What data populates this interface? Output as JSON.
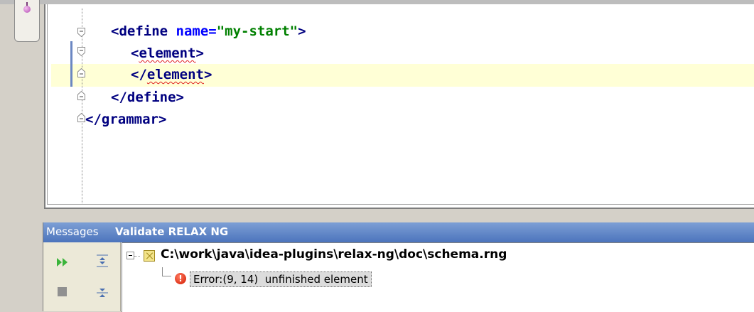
{
  "editor": {
    "lines": [
      {
        "parts": [
          [
            "tag",
            "<define "
          ],
          [
            "attr",
            "name="
          ],
          [
            "str",
            "\"my-start\""
          ],
          [
            "tag",
            ">"
          ]
        ]
      },
      {
        "parts": [
          [
            "tag",
            "<"
          ],
          [
            "tagerr",
            "element"
          ],
          [
            "tag",
            ">"
          ]
        ]
      },
      {
        "parts": [
          [
            "tag",
            "</"
          ],
          [
            "tagerr",
            "element"
          ],
          [
            "tag",
            ">"
          ]
        ]
      },
      {
        "parts": [
          [
            "tag",
            "</define>"
          ]
        ]
      },
      {
        "parts": [
          [
            "tag",
            "</grammar>"
          ]
        ]
      }
    ]
  },
  "messages": {
    "title": "Messages",
    "tab": "Validate RELAX NG",
    "file_path": "C:\\work\\java\\idea-plugins\\relax-ng\\doc\\schema.rng",
    "error_text": "Error:(9, 14)  unfinished element"
  },
  "icons": {
    "rerun": "rerun-icon",
    "stop": "stop-icon",
    "expand_all": "expand-all-icon",
    "collapse_all": "collapse-all-icon",
    "error": "error-icon",
    "file": "rng-file-icon"
  },
  "colors": {
    "tag": "#000080",
    "attr": "#0000ff",
    "string": "#008000",
    "current_line": "#ffffd6",
    "header": "#4c74bc"
  }
}
